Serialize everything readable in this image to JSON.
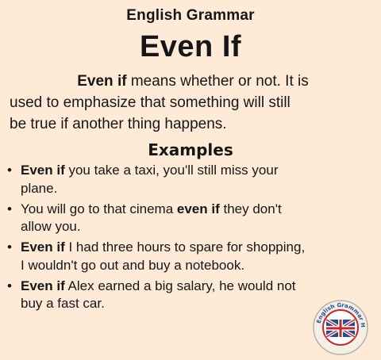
{
  "header": {
    "subtitle": "English Grammar",
    "title": "Even If"
  },
  "definition": {
    "line1_bold": "Even if",
    "line1_rest": " means whether or not. It is",
    "line2": "used to emphasize that something will still",
    "line3": "be true if another thing happens."
  },
  "examples": {
    "heading": "Examples",
    "bullet": "•",
    "items": [
      {
        "line1_pre": "",
        "line1_bold": "Even if",
        "line1_post": " you take a taxi, you'll still miss your",
        "line2": "plane."
      },
      {
        "line1_pre": "You will go to that cinema ",
        "line1_bold": "even if",
        "line1_post": " they don't",
        "line2": "allow you."
      },
      {
        "line1_pre": "",
        "line1_bold": "Even if",
        "line1_post": " I had three hours to spare for shopping,",
        "line2": "I wouldn't go out and buy a notebook."
      },
      {
        "line1_pre": "",
        "line1_bold": "Even if",
        "line1_post": " Alex earned a big salary, he would not",
        "line2": "buy a fast car."
      }
    ]
  },
  "logo": {
    "text": "English Grammar Here.Com",
    "icon": "english-grammar-here-logo",
    "colors": {
      "ring": "#f4f0e6",
      "blue": "#1f4e9c",
      "red": "#c8262b"
    }
  },
  "colors": {
    "background": "#fdebd8",
    "text": "#161616"
  }
}
